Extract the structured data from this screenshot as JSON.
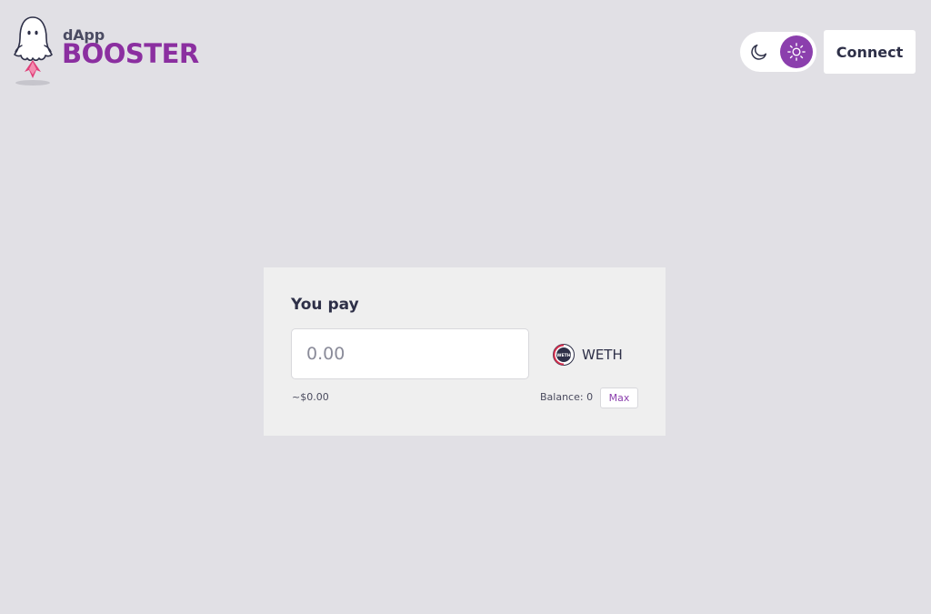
{
  "header": {
    "logo": {
      "small_text": "dApp",
      "big_text": "BOOSTER",
      "icon": "ghost-rocket-logo"
    },
    "theme_toggle": {
      "dark_icon": "moon-icon",
      "light_icon": "sun-icon",
      "selected": "light"
    },
    "connect_label": "Connect"
  },
  "swap_card": {
    "title": "You pay",
    "amount_placeholder": "0.00",
    "amount_value": "",
    "token": {
      "symbol": "WETH",
      "icon": "weth-token-icon"
    },
    "usd_value": "~$0.00",
    "balance": "Balance: 0",
    "max_label": "Max"
  },
  "colors": {
    "background": "#e1e0e5",
    "card": "#efefef",
    "accent": "#8b3fad",
    "brand": "#8b2fa0",
    "text": "#2e3048"
  }
}
